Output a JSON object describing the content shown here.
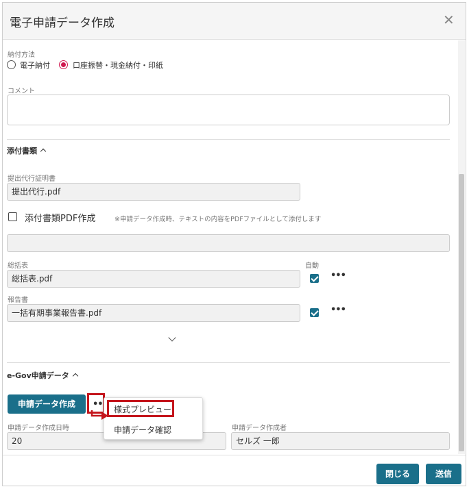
{
  "dialog": {
    "title": "電子申請データ作成",
    "close_glyph": "✕"
  },
  "payment": {
    "label": "納付方法",
    "options": [
      {
        "label": "電子納付",
        "selected": false
      },
      {
        "label": "口座振替・現金納付・印紙",
        "selected": true
      }
    ]
  },
  "comment": {
    "label": "コメント",
    "value": ""
  },
  "attachments": {
    "section_title": "添付書類",
    "proxy_cert": {
      "label": "提出代行証明書",
      "value": "提出代行.pdf"
    },
    "pdf_create": {
      "label": "添付書類PDF作成",
      "checked": false,
      "note": "※申請データ作成時、テキストの内容をPDFファイルとして添付します",
      "value": ""
    },
    "auto_label": "自動",
    "summary": {
      "label": "総括表",
      "value": "総括表.pdf",
      "auto_checked": true
    },
    "report": {
      "label": "報告書",
      "value": "一括有期事業報告書.pdf",
      "auto_checked": true
    },
    "more_glyph": "•••"
  },
  "egov": {
    "section_title": "e-Gov申請データ",
    "create_button": "申請データ作成",
    "more_glyph": "•••",
    "created_at": {
      "label": "申請データ作成日時",
      "value": "20"
    },
    "creator": {
      "label": "申請データ作成者",
      "value": "セルズ 一郎"
    }
  },
  "context_menu": {
    "items": [
      "様式プレビュー",
      "申請データ確認"
    ]
  },
  "footer": {
    "close_button": "閉じる",
    "send_button": "送信"
  },
  "colors": {
    "primary": "#1a6f8a",
    "radio_selected": "#d0184f",
    "highlight": "#c4151c"
  }
}
